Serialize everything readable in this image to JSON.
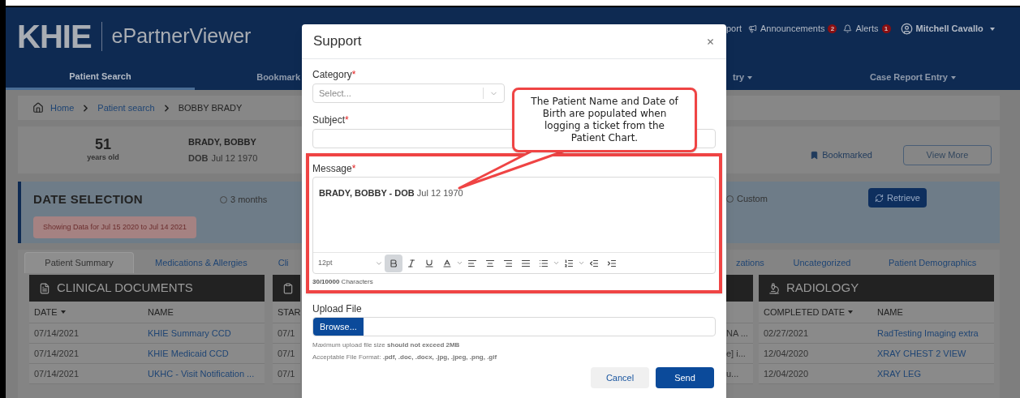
{
  "header": {
    "logo": "KHIE",
    "app_name": "ePartnerViewer",
    "links": [
      {
        "kind": "plain",
        "label": "port"
      },
      {
        "kind": "megaphone",
        "label": "Announcements",
        "badge": "2"
      },
      {
        "kind": "bell",
        "label": "Alerts",
        "badge": "1"
      }
    ],
    "user": {
      "name": "Mitchell Cavallo",
      "has_menu": true
    }
  },
  "nav_left": [
    {
      "label": "Patient Search",
      "selected": true,
      "has_menu": false
    },
    {
      "label": "Bookmark",
      "selected": false,
      "has_menu": false
    }
  ],
  "nav_right": [
    {
      "label": "try",
      "selected": false,
      "has_menu": true
    },
    {
      "label": "Case Report Entry",
      "selected": false,
      "has_menu": true
    }
  ],
  "breadcrumb": [
    "Home",
    "Patient search",
    "BOBBY BRADY"
  ],
  "patient": {
    "age": "51",
    "age_label": "years old",
    "name": "BRADY, BOBBY",
    "dob_label": "DOB",
    "dob": "Jul 12 1970",
    "bookmark": "Bookmarked",
    "view_more": "View More"
  },
  "date_selection": {
    "title": "DATE SELECTION",
    "options": [
      {
        "label": "3 months",
        "selected": false
      },
      {
        "label": "Custom",
        "selected": false
      }
    ],
    "showing": "Showing Data for Jul 15 2020 to Jul 14 2021",
    "retrieve": "Retrieve"
  },
  "tabs_left": [
    {
      "label": "Patient Summary",
      "selected": true
    },
    {
      "label": "Medications & Allergies",
      "selected": false
    },
    {
      "label": "Cli",
      "selected": false
    }
  ],
  "tabs_right": [
    {
      "label": "zations",
      "selected": false
    },
    {
      "label": "Uncategorized",
      "selected": false
    },
    {
      "label": "Patient Demographics",
      "selected": false
    }
  ],
  "panels_left": [
    {
      "title": "CLINICAL DOCUMENTS",
      "columns": [
        {
          "label": "DATE",
          "kind": "text",
          "sorted": true
        },
        {
          "label": "NAME",
          "kind": "link",
          "sorted": false
        }
      ],
      "rows": [
        [
          "07/14/2021",
          "KHIE Summary CCD"
        ],
        [
          "07/14/2021",
          "KHIE Medicaid CCD"
        ],
        [
          "07/14/2021",
          "UKHC - Visit Notification ..."
        ]
      ]
    },
    {
      "columns": [
        {
          "label": "STAR",
          "kind": "text",
          "sorted": false
        }
      ],
      "rows": [
        [
          "07/1"
        ],
        [
          "07/1"
        ],
        [
          "07/1"
        ]
      ]
    }
  ],
  "panels_right": [
    {
      "rows": [
        [
          "NA ..."
        ],
        [
          "e] i..."
        ],
        [
          "u..."
        ]
      ]
    },
    {
      "title": "RADIOLOGY",
      "columns": [
        {
          "label": "COMPLETED DATE",
          "kind": "text",
          "sorted": true
        },
        {
          "label": "NAME",
          "kind": "link",
          "sorted": false
        }
      ],
      "rows": [
        [
          "02/27/2021",
          "RadTesting Imaging extra"
        ],
        [
          "12/04/2020",
          "XRAY CHEST 2 VIEW"
        ],
        [
          "12/04/2020",
          "XRAY LEG"
        ]
      ]
    }
  ],
  "modal": {
    "title": "Support",
    "category": {
      "label": "Category",
      "required_mark": "*",
      "placeholder": "Select..."
    },
    "subject": {
      "label": "Subject",
      "required_mark": "*"
    },
    "message": {
      "label": "Message",
      "required_mark": "*",
      "value": "**BRADY, BOBBY - DOB** Jul 12 1970",
      "highlighted": true,
      "font_size": "12pt",
      "toolbar": [
        {
          "kind": "bold",
          "selected": true
        },
        {
          "kind": "italic",
          "selected": false
        },
        {
          "kind": "underline",
          "selected": false
        },
        {
          "kind": "color",
          "selected": false
        },
        {
          "kind": "align-left",
          "selected": false
        },
        {
          "kind": "align-center",
          "selected": false
        },
        {
          "kind": "align-right",
          "selected": false
        },
        {
          "kind": "justify",
          "selected": false
        },
        {
          "kind": "bullets",
          "selected": false
        },
        {
          "kind": "numbers",
          "selected": false
        },
        {
          "kind": "outdent",
          "selected": false
        },
        {
          "kind": "indent",
          "selected": false
        }
      ],
      "counter": "**30/10000** Characters"
    },
    "upload": {
      "label": "Upload File",
      "browse": "Browse...",
      "notes": [
        "Maximum upload file size **should not exceed 2MB**",
        "Acceptable File Format: **.pdf, .doc, .docx, .jpg, .jpeg, .png, .gif**"
      ]
    },
    "buttons": [
      {
        "kind": "secondary",
        "label": "Cancel"
      },
      {
        "kind": "primary",
        "label": "Send"
      }
    ]
  },
  "callout": {
    "text": "The Patient Name and Date of Birth are populated when logging a ticket from the Patient Chart."
  }
}
